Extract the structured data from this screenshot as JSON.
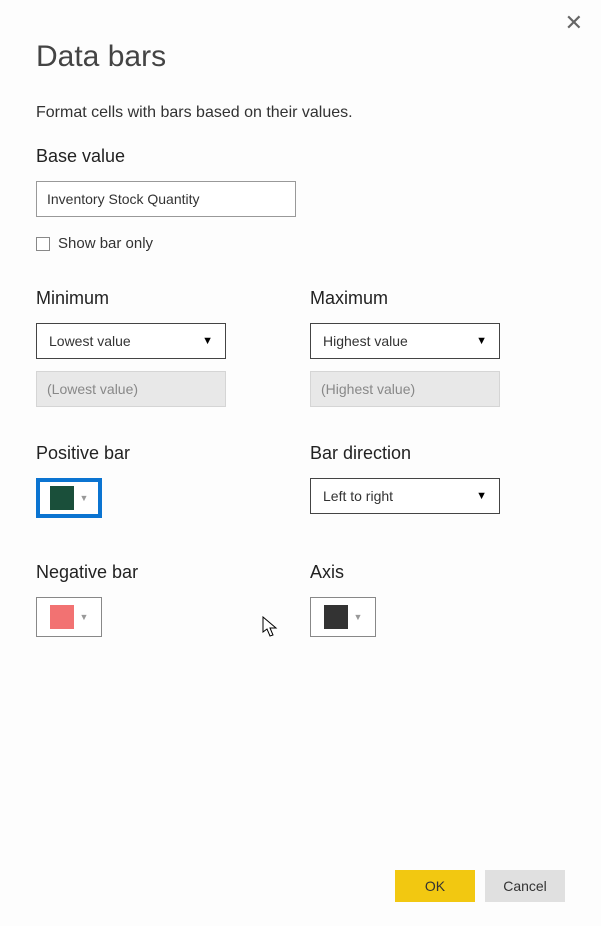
{
  "title": "Data bars",
  "description": "Format cells with bars based on their values.",
  "base_value": {
    "label": "Base value",
    "value": "Inventory Stock Quantity"
  },
  "show_bar_only": {
    "label": "Show bar only",
    "checked": false
  },
  "minimum": {
    "label": "Minimum",
    "dropdown": "Lowest value",
    "placeholder": "(Lowest value)"
  },
  "maximum": {
    "label": "Maximum",
    "dropdown": "Highest value",
    "placeholder": "(Highest value)"
  },
  "positive_bar": {
    "label": "Positive bar",
    "color": "#1a4f3a"
  },
  "bar_direction": {
    "label": "Bar direction",
    "dropdown": "Left to right"
  },
  "negative_bar": {
    "label": "Negative bar",
    "color": "#f27272"
  },
  "axis": {
    "label": "Axis",
    "color": "#333333"
  },
  "buttons": {
    "ok": "OK",
    "cancel": "Cancel"
  }
}
